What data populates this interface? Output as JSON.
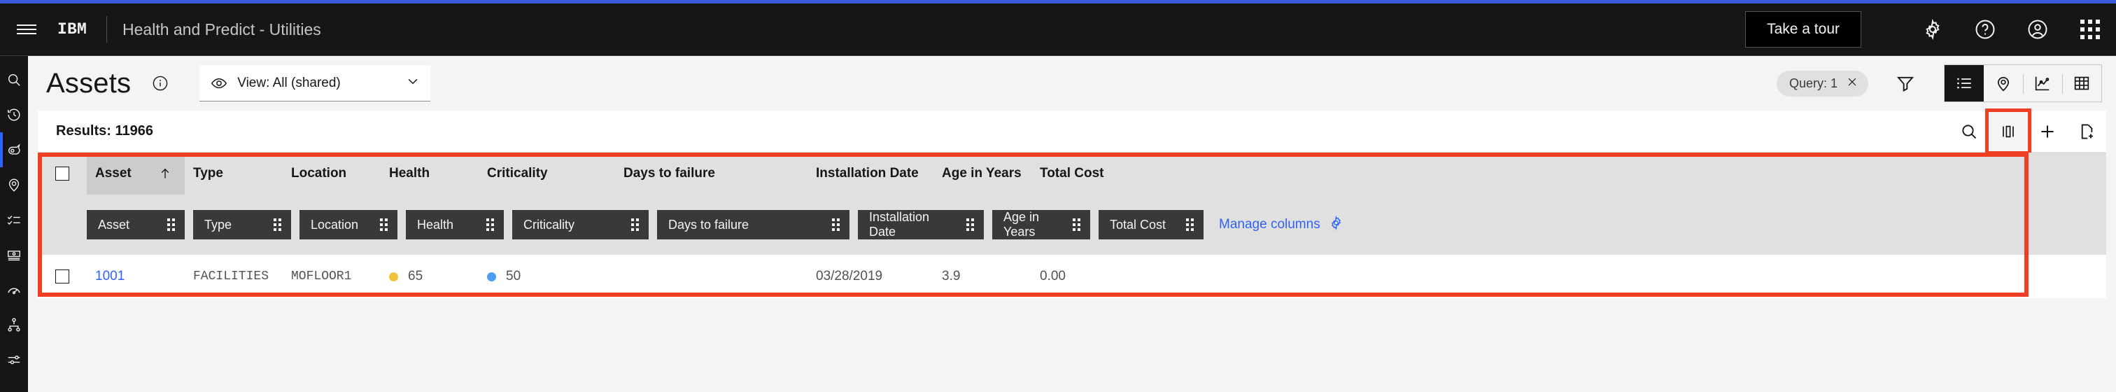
{
  "header": {
    "brand": "IBM",
    "title": "Health and Predict - Utilities",
    "take_tour_label": "Take a tour",
    "icons": [
      "menu-icon",
      "gear-icon",
      "help-icon",
      "user-avatar-icon",
      "app-switcher-icon"
    ]
  },
  "sidebar": {
    "items": [
      {
        "name": "search",
        "label": "Search"
      },
      {
        "name": "recent",
        "label": "Recently viewed"
      },
      {
        "name": "assets",
        "label": "Assets"
      },
      {
        "name": "locations",
        "label": "Locations"
      },
      {
        "name": "work-orders",
        "label": "Work orders"
      },
      {
        "name": "meters",
        "label": "Meters"
      },
      {
        "name": "monitoring",
        "label": "Monitoring"
      },
      {
        "name": "hierarchy",
        "label": "Hierarchy"
      },
      {
        "name": "settings",
        "label": "Settings"
      }
    ]
  },
  "page": {
    "title": "Assets",
    "view_select": {
      "label": "View: All (shared)",
      "icon": "eye-icon"
    },
    "query_tag": {
      "label": "Query: 1"
    },
    "view_modes": [
      {
        "name": "list",
        "selected": true
      },
      {
        "name": "map",
        "selected": false
      },
      {
        "name": "chart",
        "selected": false
      },
      {
        "name": "grid",
        "selected": false
      }
    ]
  },
  "results": {
    "label": "Results: 11966",
    "toolbar": [
      {
        "name": "search-icon",
        "highlighted": false
      },
      {
        "name": "columns-icon",
        "highlighted": true
      },
      {
        "name": "plus-icon",
        "highlighted": false
      },
      {
        "name": "new-document-icon",
        "highlighted": false
      }
    ]
  },
  "table": {
    "columns": [
      {
        "key": "asset",
        "header": "Asset",
        "sorted": true,
        "sort_dir": "asc",
        "width_class": "c-asset"
      },
      {
        "key": "type",
        "header": "Type",
        "sorted": false,
        "width_class": "c-type"
      },
      {
        "key": "location",
        "header": "Location",
        "sorted": false,
        "width_class": "c-loc"
      },
      {
        "key": "health",
        "header": "Health",
        "sorted": false,
        "width_class": "c-hl"
      },
      {
        "key": "crit",
        "header": "Criticality",
        "sorted": false,
        "width_class": "c-crit"
      },
      {
        "key": "dtf",
        "header": "Days to failure",
        "sorted": false,
        "width_class": "c-dtf"
      },
      {
        "key": "inst",
        "header": "Installation Date",
        "sorted": false,
        "width_class": "c-inst"
      },
      {
        "key": "age",
        "header": "Age in Years",
        "sorted": false,
        "width_class": "c-age"
      },
      {
        "key": "cost",
        "header": "Total Cost",
        "sorted": false,
        "width_class": "c-cost"
      }
    ],
    "chips": [
      "Asset",
      "Type",
      "Location",
      "Health",
      "Criticality",
      "Days to failure",
      "Installation Date",
      "Age in Years",
      "Total Cost"
    ],
    "manage_columns_label": "Manage columns",
    "rows": [
      {
        "asset": "1001",
        "type": "FACILITIES",
        "location": "MOFLOOR1",
        "health": "65",
        "health_color": "#f0c33c",
        "crit": "50",
        "crit_color": "#4d9ef0",
        "dtf": "",
        "inst": "03/28/2019",
        "age": "3.9",
        "cost": "0.00"
      }
    ]
  },
  "colors": {
    "accent_blue": "#2f62f5",
    "annotation_red": "#ef3e24",
    "header_dark": "#161616"
  }
}
